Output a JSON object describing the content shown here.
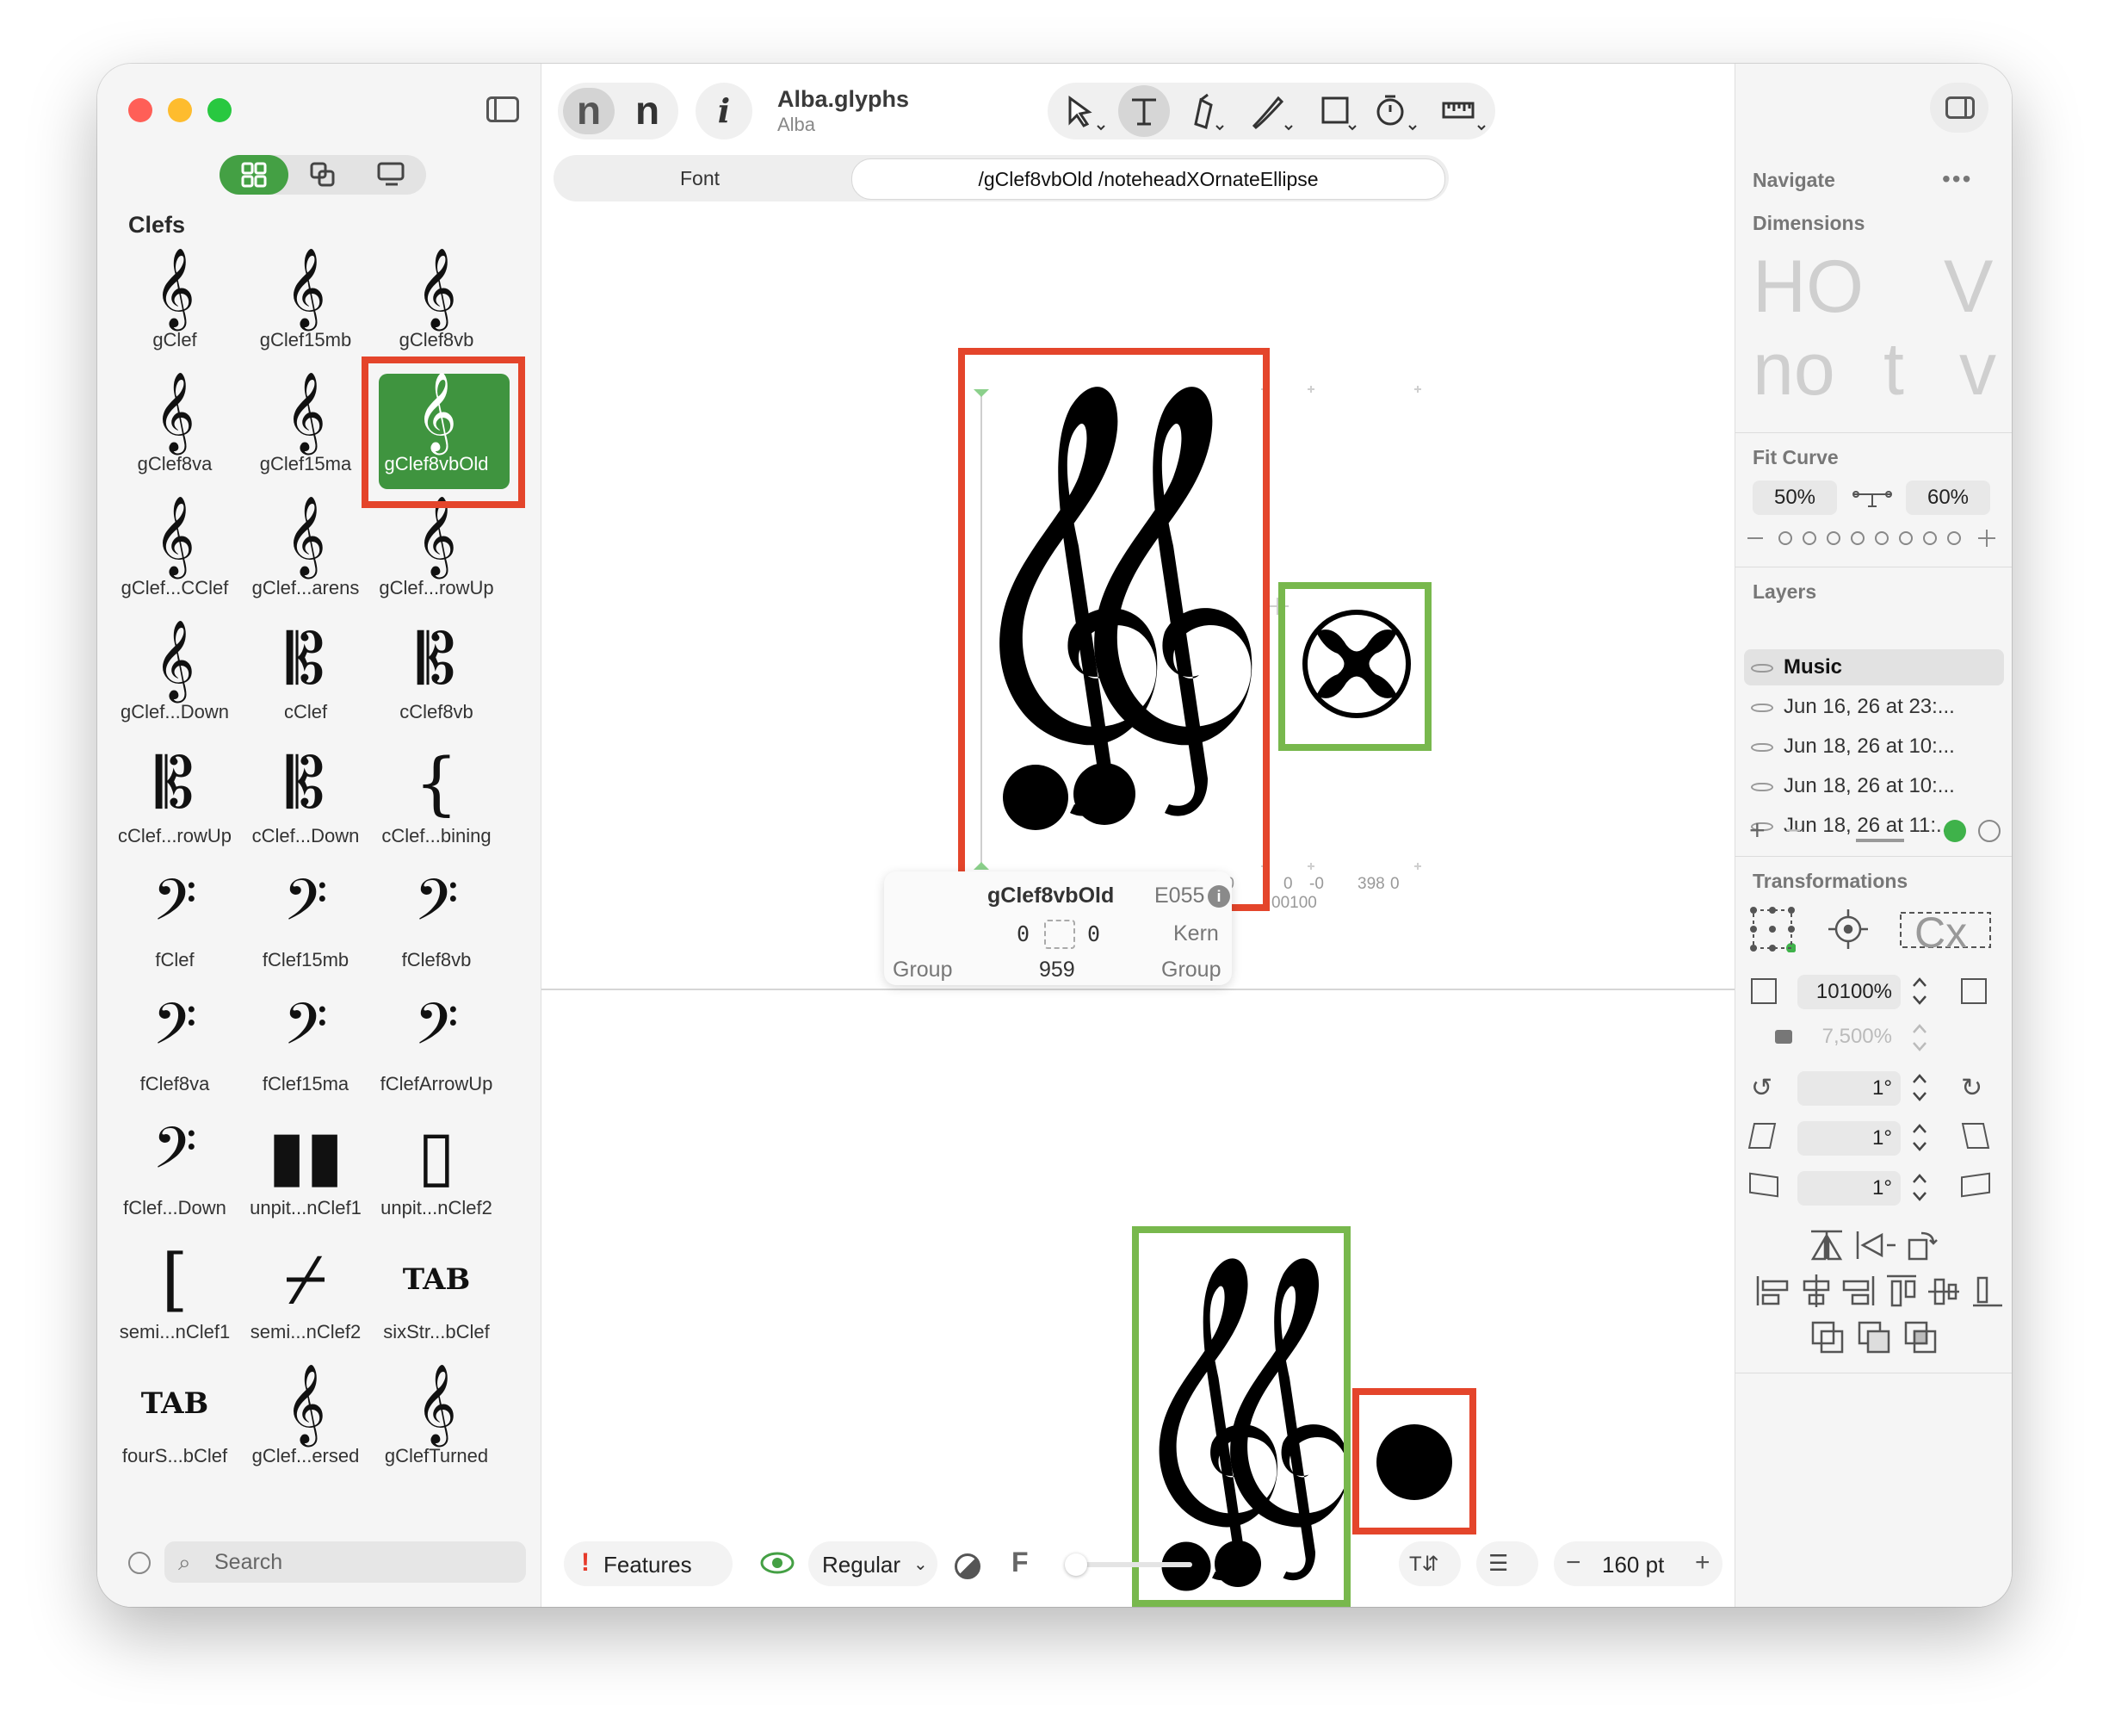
{
  "app": {
    "file_title": "Alba.glyphs",
    "family_name": "Alba"
  },
  "sidebar": {
    "section_title": "Clefs",
    "search_placeholder": "Search",
    "glyphs": [
      {
        "label": "gClef",
        "char": "𝄞"
      },
      {
        "label": "gClef15mb",
        "char": "𝄞"
      },
      {
        "label": "gClef8vb",
        "char": "𝄞"
      },
      {
        "label": "gClef8va",
        "char": "𝄞"
      },
      {
        "label": "gClef15ma",
        "char": "𝄞"
      },
      {
        "label": "gClef8vbOld",
        "char": "𝄞"
      },
      {
        "label": "gClef...CClef",
        "char": "𝄞"
      },
      {
        "label": "gClef...arens",
        "char": "𝄞"
      },
      {
        "label": "gClef...rowUp",
        "char": "𝄞"
      },
      {
        "label": "gClef...Down",
        "char": "𝄞"
      },
      {
        "label": "cClef",
        "char": "𝄡"
      },
      {
        "label": "cClef8vb",
        "char": "𝄡"
      },
      {
        "label": "cClef...rowUp",
        "char": "𝄡"
      },
      {
        "label": "cClef...Down",
        "char": "𝄡"
      },
      {
        "label": "cClef...bining",
        "char": "{"
      },
      {
        "label": "fClef",
        "char": "𝄢"
      },
      {
        "label": "fClef15mb",
        "char": "𝄢"
      },
      {
        "label": "fClef8vb",
        "char": "𝄢"
      },
      {
        "label": "fClef8va",
        "char": "𝄢"
      },
      {
        "label": "fClef15ma",
        "char": "𝄢"
      },
      {
        "label": "fClefArrowUp",
        "char": "𝄢"
      },
      {
        "label": "fClef...Down",
        "char": "𝄢"
      },
      {
        "label": "unpit...nClef1",
        "char": "▮▮"
      },
      {
        "label": "unpit...nClef2",
        "char": "▯"
      },
      {
        "label": "semi...nClef1",
        "char": "["
      },
      {
        "label": "semi...nClef2",
        "char": "⌿"
      },
      {
        "label": "sixStr...bClef",
        "char": "TAB"
      },
      {
        "label": "fourS...bClef",
        "char": "TAB"
      },
      {
        "label": "gClef...ersed",
        "char": "𝄞"
      },
      {
        "label": "gClefTurned",
        "char": "𝄞"
      }
    ]
  },
  "tabs": {
    "font_label": "Font",
    "active_text": "/gClef8vbOld   /noteheadXOrnateEllipse"
  },
  "editor": {
    "metrics": {
      "lsb_left": "-0",
      "advance_1": "959",
      "rsb_1": "-0",
      "lsb_2": "0",
      "rsb_2": "-0",
      "advance_2": "398",
      "rsb_2b": "0",
      "sub_2": "00100"
    },
    "info": {
      "glyph_name": "gClef8vbOld",
      "unicode": "E055",
      "lsb": "0",
      "rsb": "0",
      "kern_label": "Kern",
      "left_group": "Group",
      "width": "959",
      "right_group": "Group"
    }
  },
  "bottom_bar": {
    "features_label": "Features",
    "master_label": "Regular",
    "f_label": "F",
    "size_value": "160 pt"
  },
  "right_panel": {
    "navigate_label": "Navigate",
    "dimensions_label": "Dimensions",
    "dim_preview_1": "HO",
    "dim_preview_2": "V",
    "dim_preview_3": "no",
    "dim_preview_4": "t",
    "dim_preview_5": "v",
    "fit_curve_label": "Fit Curve",
    "fit_min": "50%",
    "fit_max": "60%",
    "layers_label": "Layers",
    "layers": [
      {
        "name": "Music",
        "active": true
      },
      {
        "name": "Jun 16, 26 at 23:..."
      },
      {
        "name": "Jun 18, 26 at 10:..."
      },
      {
        "name": "Jun 18, 26 at 10:..."
      },
      {
        "name": "Jun 18, 26 at 11:..."
      }
    ],
    "transformations_label": "Transformations",
    "scale_value": "10100%",
    "scale_locked_value": "7,500%",
    "rotate_value": "1°",
    "slant_value": "1°",
    "skew_value": "1°",
    "cx_label": "Cx"
  },
  "colors": {
    "accent_green": "#44a044",
    "highlight_red": "#e4452b",
    "highlight_green": "#78b84d"
  }
}
